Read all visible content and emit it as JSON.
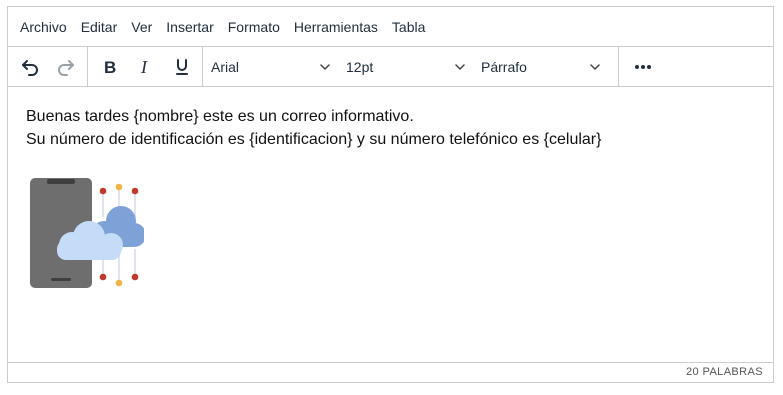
{
  "menubar": {
    "items": [
      "Archivo",
      "Editar",
      "Ver",
      "Insertar",
      "Formato",
      "Herramientas",
      "Tabla"
    ]
  },
  "toolbar": {
    "font_family": "Arial",
    "font_size": "12pt",
    "block_format": "Párrafo",
    "icons": [
      "undo-icon",
      "redo-icon",
      "bold-icon",
      "italic-icon",
      "underline-icon",
      "more-icon"
    ]
  },
  "content": {
    "line1": "Buenas tardes {nombre} este es un correo informativo.",
    "line2": "Su número de identificación es {identificacion} y su número telefónico es {celular}"
  },
  "statusbar": {
    "word_count": "20 PALABRAS"
  },
  "colors": {
    "phone": "#6e6e6e",
    "cloud_front": "#c4dcf8",
    "cloud_back": "#7ea2d8",
    "node_red": "#c0392b",
    "node_orange": "#f0b445",
    "border": "#cccccc"
  }
}
